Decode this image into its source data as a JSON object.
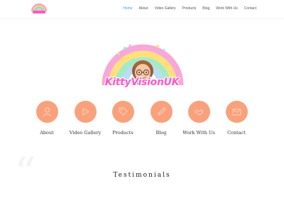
{
  "header": {
    "logo_text": "KittyVisionUK",
    "nav": [
      {
        "label": "Home",
        "active": true
      },
      {
        "label": "About",
        "active": false
      },
      {
        "label": "Video Gallery",
        "active": false
      },
      {
        "label": "Products",
        "active": false
      },
      {
        "label": "Blog",
        "active": false
      },
      {
        "label": "Work With Us",
        "active": false
      },
      {
        "label": "Contact",
        "active": false
      }
    ]
  },
  "hero": {
    "title": "KittyVisionUK"
  },
  "circles": [
    {
      "label": "About",
      "icon": "user-icon"
    },
    {
      "label": "Video Gallery",
      "icon": "video-icon"
    },
    {
      "label": "Products",
      "icon": "tag-icon"
    },
    {
      "label": "Blog",
      "icon": "pen-icon"
    },
    {
      "label": "Work With Us",
      "icon": "handshake-icon"
    },
    {
      "label": "Contact",
      "icon": "mail-icon"
    }
  ],
  "testimonials": {
    "title": "Testimonials"
  },
  "colors": {
    "accent": "#2ea3f2",
    "circle": "#f9a17c",
    "brand_pink": "#ff57c8"
  }
}
